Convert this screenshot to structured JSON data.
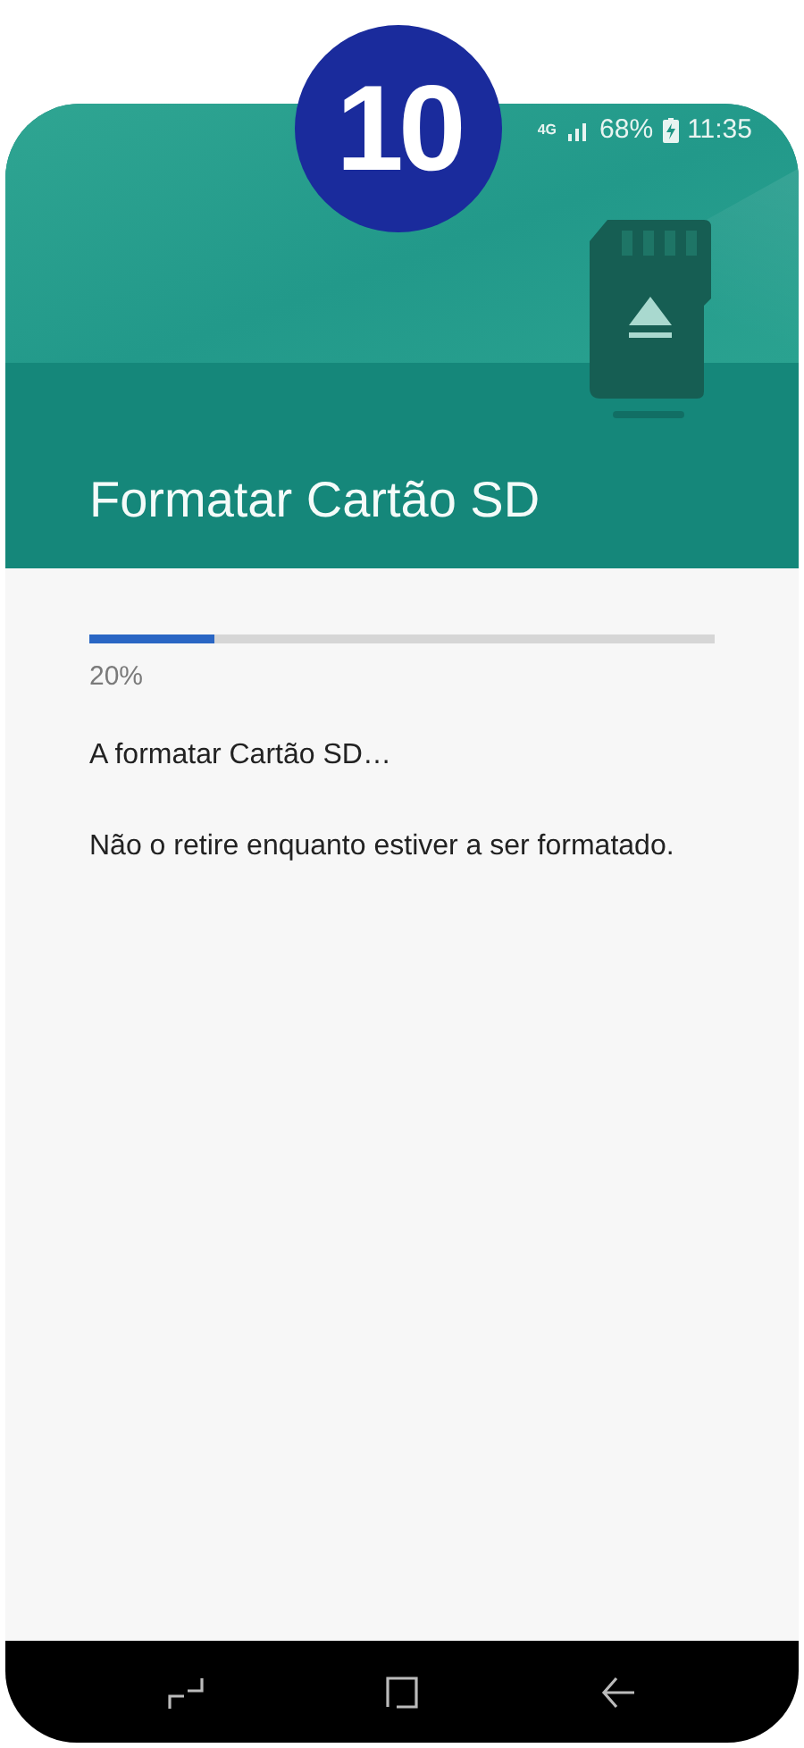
{
  "step_badge": "10",
  "status_bar": {
    "network": "4G",
    "battery": "68%",
    "time": "11:35"
  },
  "header": {
    "title": "Formatar Cartão SD"
  },
  "progress": {
    "level": 0.2,
    "reading": "20%"
  },
  "messages": [
    "A formatar Cartão SD…",
    "Não o retire enquanto estiver a ser formatado."
  ]
}
